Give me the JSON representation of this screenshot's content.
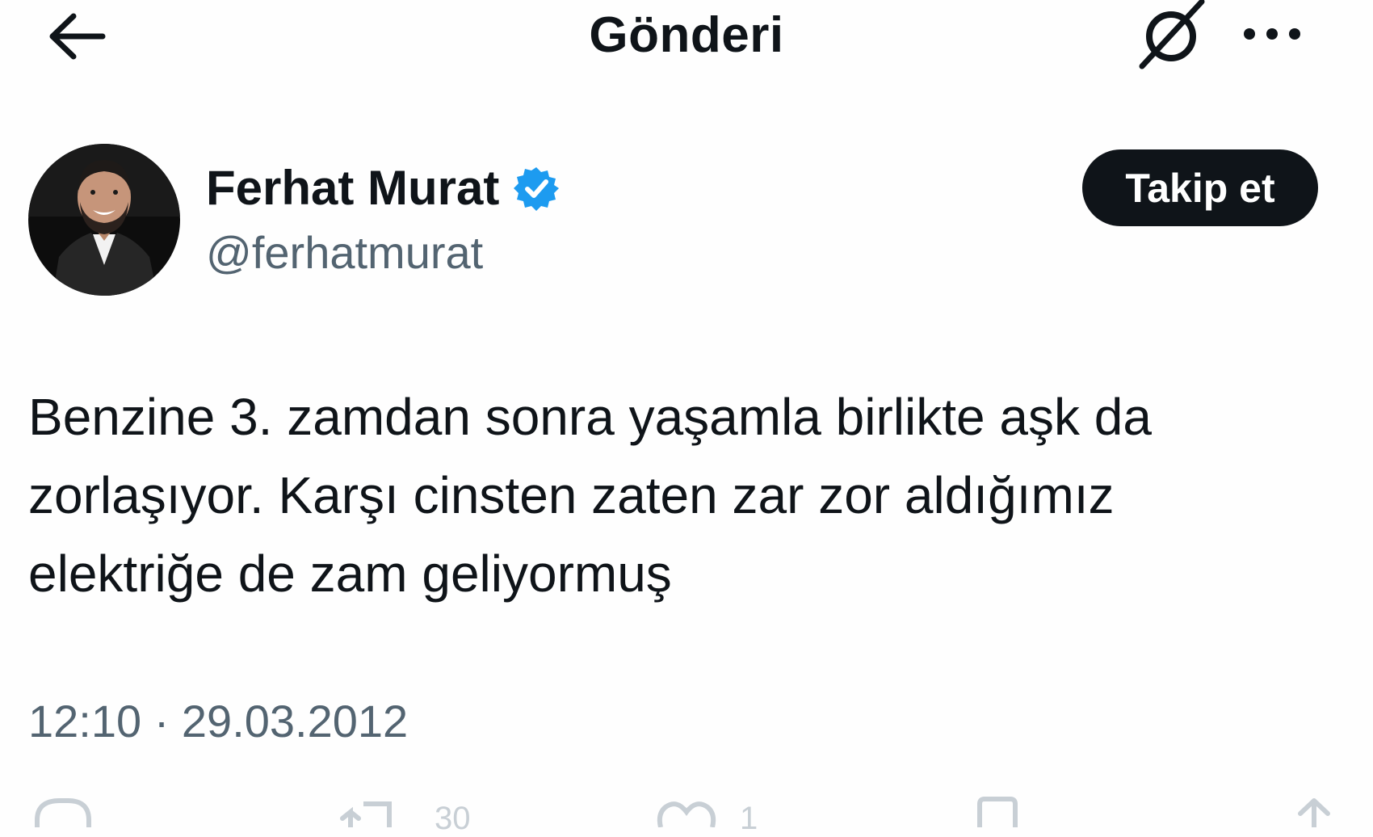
{
  "header": {
    "title": "Gönderi"
  },
  "author": {
    "display_name": "Ferhat Murat",
    "handle": "@ferhatmurat",
    "verified": true
  },
  "follow_button": {
    "label": "Takip et"
  },
  "tweet": {
    "text_lines": [
      "Benzine 3. zamdan sonra yaşamla birlikte aşk da",
      "zorlaşıyor. Karşı cinsten zaten zar zor aldığımız",
      "elektriğe de zam geliyormuş"
    ],
    "timestamp": "12:10 · 29.03.2012"
  },
  "actions": {
    "reply_icon": "reply-icon",
    "retweet_icon": "retweet-icon",
    "retweet_count": "30",
    "like_icon": "heart-icon",
    "like_count": "1",
    "bookmark_icon": "bookmark-icon",
    "share_icon": "share-icon"
  },
  "colors": {
    "text": "#0f1419",
    "secondary_text": "#536471",
    "verified_blue": "#1d9bf0",
    "follow_bg": "#0f1419"
  }
}
